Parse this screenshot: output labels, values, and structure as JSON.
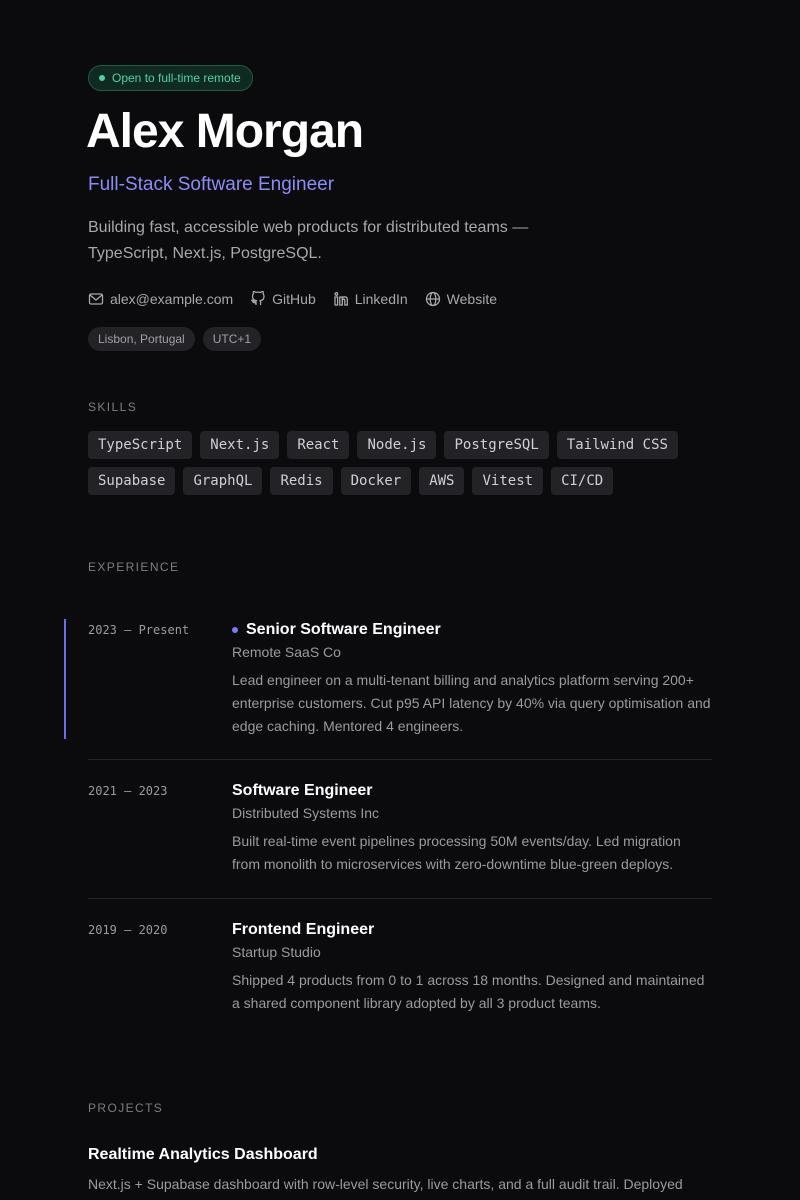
{
  "status": "Open to full-time remote",
  "name": "Alex Morgan",
  "role": "Full-Stack Software Engineer",
  "bio": "Building fast, accessible web products for distributed teams — TypeScript, Next.js, PostgreSQL.",
  "contacts": [
    {
      "label": "alex@example.com",
      "icon": "mail-icon"
    },
    {
      "label": "GitHub",
      "icon": "github-icon"
    },
    {
      "label": "LinkedIn",
      "icon": "linkedin-icon"
    },
    {
      "label": "Website",
      "icon": "globe-icon"
    }
  ],
  "tags": [
    "Lisbon, Portugal",
    "UTC+1"
  ],
  "sections": {
    "skills": "SKILLS",
    "experience": "EXPERIENCE",
    "projects": "PROJECTS"
  },
  "skills": [
    "TypeScript",
    "Next.js",
    "React",
    "Node.js",
    "PostgreSQL",
    "Tailwind CSS",
    "Supabase",
    "GraphQL",
    "Redis",
    "Docker",
    "AWS",
    "Vitest",
    "CI/CD"
  ],
  "experience": [
    {
      "dates": "2023 — Present",
      "title": "Senior Software Engineer",
      "company": "Remote SaaS Co",
      "desc": "Lead engineer on a multi-tenant billing and analytics platform serving 200+ enterprise customers. Cut p95 API latency by 40% via query optimisation and edge caching. Mentored 4 engineers.",
      "current": true
    },
    {
      "dates": "2021 — 2023",
      "title": "Software Engineer",
      "company": "Distributed Systems Inc",
      "desc": "Built real-time event pipelines processing 50M events/day. Led migration from monolith to microservices with zero-downtime blue-green deploys.",
      "current": false
    },
    {
      "dates": "2019 — 2020",
      "title": "Frontend Engineer",
      "company": "Startup Studio",
      "desc": "Shipped 4 products from 0 to 1 across 18 months. Designed and maintained a shared component library adopted by all 3 product teams.",
      "current": false
    }
  ],
  "projects": [
    {
      "title": "Realtime Analytics Dashboard",
      "desc": "Next.js + Supabase dashboard with row-level security, live charts, and a full audit trail. Deployed"
    }
  ],
  "colors": {
    "background": "#0b0b0d",
    "accent": "#8b8cf6",
    "status": "#4fd3a0"
  }
}
